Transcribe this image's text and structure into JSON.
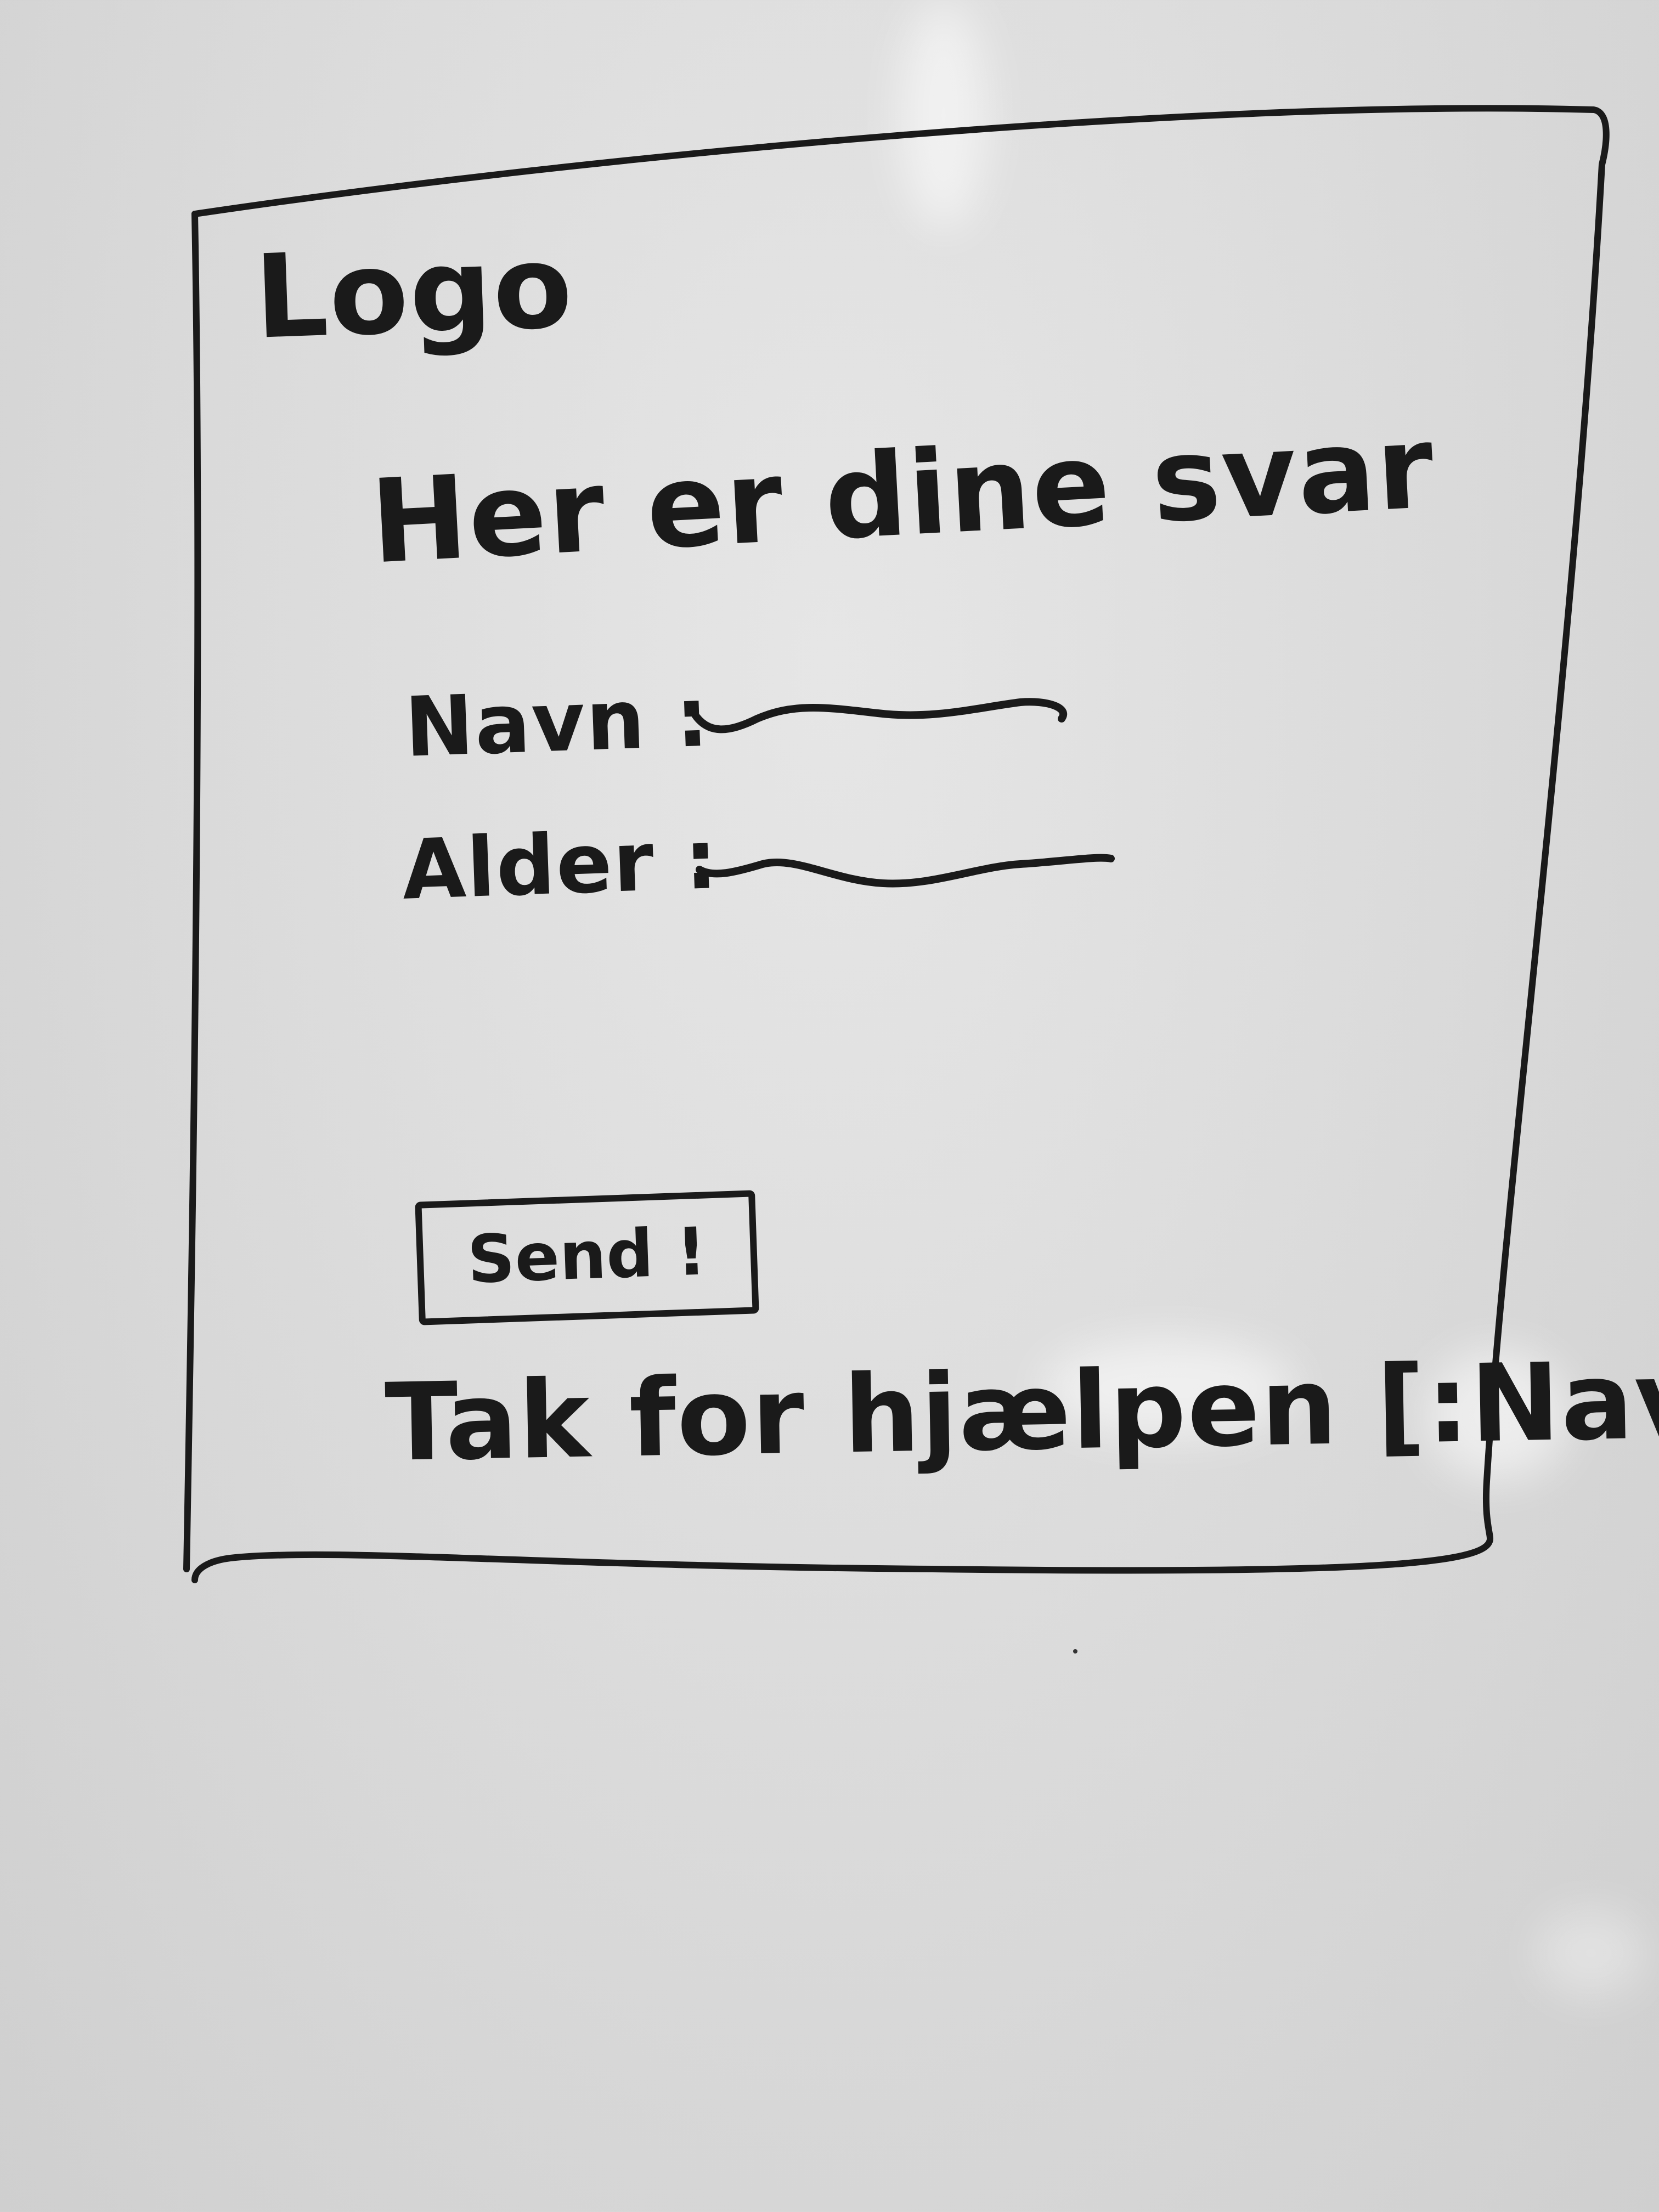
{
  "header": {
    "logo_text": "Logo"
  },
  "main": {
    "title": "Her er dine svar",
    "fields": [
      {
        "label": "Navn :"
      },
      {
        "label": "Alder :"
      }
    ],
    "send_button_label": "Send !",
    "thanks_text": "Tak for hjælpen",
    "thanks_placeholder": "[:Navn]"
  },
  "colors": {
    "ink": "#1a1a1a",
    "board": "#dcdcdc"
  }
}
